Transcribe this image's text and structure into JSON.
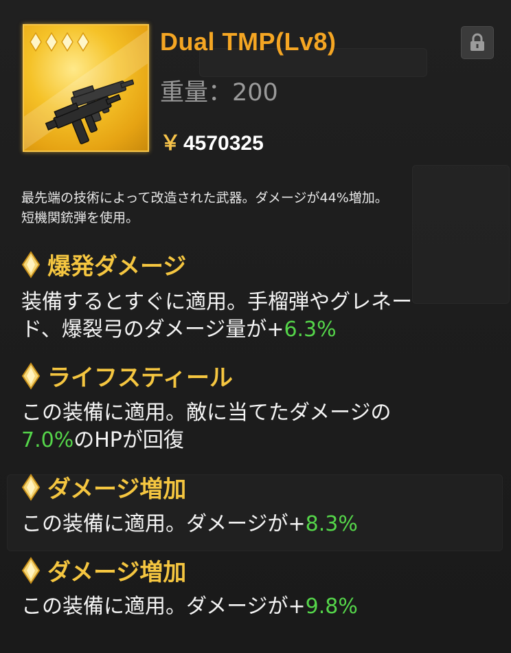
{
  "item": {
    "name": "Dual TMP(Lv8)",
    "weight": "重量：200",
    "price_symbol": "￥",
    "price": "4570325",
    "stars": 4,
    "icon": "submachine-gun-icon",
    "rarity_color": "#f5c228"
  },
  "lock": {
    "icon": "lock-icon"
  },
  "description_lines": [
    "最先端の技術によって改造された武器。ダメージが44%増加。",
    "短機関銃弾を使用。"
  ],
  "skills": [
    {
      "title": "爆発ダメージ",
      "line1": "装備するとすぐに適用。手榴弾やグレネー",
      "line2_prefix": "ド、爆裂弓のダメージ量が+",
      "value": "6.3%",
      "line2_suffix": ""
    },
    {
      "title": "ライフスティール",
      "line1": "この装備に適用。敵に当てたダメージの",
      "line2_prefix": "",
      "value": "7.0%",
      "line2_suffix": "のHPが回復"
    },
    {
      "title": "ダメージ増加",
      "line1_prefix": "この装備に適用。ダメージが+",
      "value": "8.3%"
    },
    {
      "title": "ダメージ増加",
      "line1_prefix": "この装備に適用。ダメージが+",
      "value": "9.8%"
    }
  ],
  "colors": {
    "title": "#f5a623",
    "skill_title": "#f5c640",
    "value_green": "#55d64a",
    "background": "#1d1d1d"
  }
}
